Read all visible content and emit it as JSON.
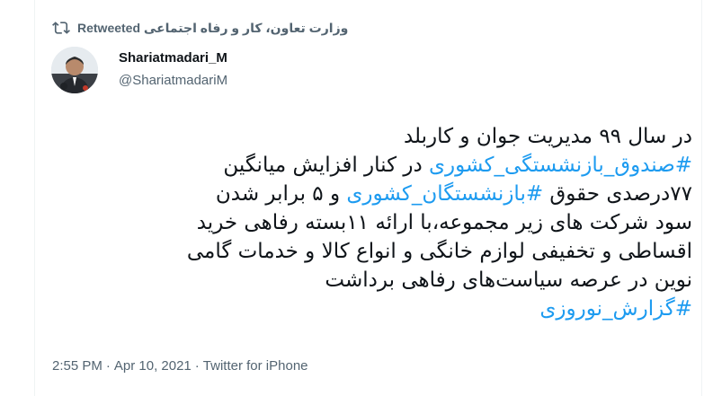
{
  "retweet": {
    "icon": "retweet-icon",
    "text": "وزارت تعاون، کار و رفاه اجتماعی Retweeted"
  },
  "author": {
    "display_name": "Shariatmadari_M",
    "handle": "@ShariatmadariM",
    "avatar_icon": "avatar-photo"
  },
  "tweet": {
    "lines": [
      [
        {
          "t": "در سال ۹۹ مدیریت جوان و کاربلد",
          "tag": false
        }
      ],
      [
        {
          "t": "#صندوق_بازنشستگی_کشوری",
          "tag": true
        },
        {
          "t": " در کنار افزایش میانگین",
          "tag": false
        }
      ],
      [
        {
          "t": "۷۷درصدی حقوق ",
          "tag": false
        },
        {
          "t": "#بازنشستگان_کشوری",
          "tag": true
        },
        {
          "t": " و ۵ برابر شدن",
          "tag": false
        }
      ],
      [
        {
          "t": "سود شرکت های زیر مجموعه،با ارائه ۱۱بسته رفاهی  خرید",
          "tag": false
        }
      ],
      [
        {
          "t": "اقساطی و تخفیفی لوازم خانگی و انواع کالا و خدمات گامی",
          "tag": false
        }
      ],
      [
        {
          "t": "نوین در عرصه سیاست‌های رفاهی برداشت",
          "tag": false
        }
      ],
      [
        {
          "t": "#گزارش_نوروزی",
          "tag": true
        }
      ]
    ]
  },
  "meta": {
    "time": "2:55 PM",
    "sep1": "·",
    "date": "Apr 10, 2021",
    "sep2": "·",
    "source": "Twitter for iPhone"
  },
  "colors": {
    "hashtag": "#1d9bf0",
    "secondary": "#536471",
    "text": "#0f1419"
  }
}
